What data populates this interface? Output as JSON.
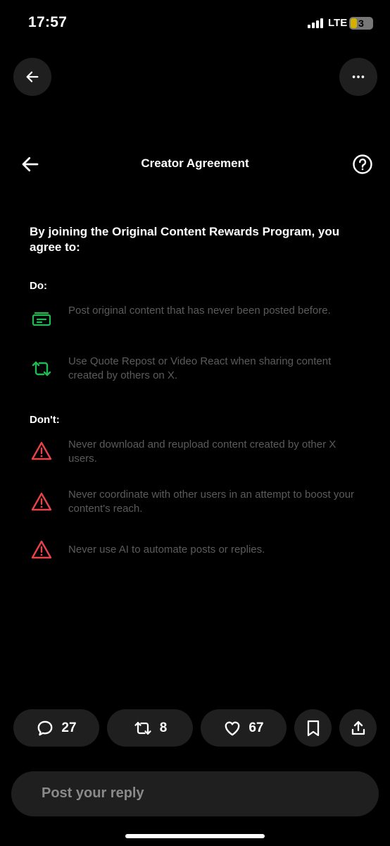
{
  "status_bar": {
    "time": "17:57",
    "network": "LTE",
    "battery": "3"
  },
  "header": {
    "title": "Creator Agreement"
  },
  "intro": "By joining the Original Content Rewards Program, you agree to:",
  "do_section": {
    "heading": "Do:",
    "items": [
      {
        "icon": "card-icon",
        "text": "Post original content that has never been posted before."
      },
      {
        "icon": "repost-icon",
        "text": "Use Quote Repost or Video React when sharing content created by others on X."
      }
    ]
  },
  "dont_section": {
    "heading": "Don't:",
    "items": [
      {
        "icon": "warning-icon",
        "text": "Never download and reupload content created by other X users."
      },
      {
        "icon": "warning-icon",
        "text": "Never coordinate with other users in an attempt to boost your content's reach."
      },
      {
        "icon": "warning-icon",
        "text": "Never use AI to automate posts or replies."
      }
    ]
  },
  "actions": {
    "replies": "27",
    "reposts": "8",
    "likes": "67"
  },
  "reply_box": {
    "placeholder": "Post your reply"
  },
  "colors": {
    "do_green": "#1fb955",
    "dont_red": "#e8434a",
    "muted_text": "#5b5b5b",
    "pill_bg": "#1f1f1f"
  }
}
